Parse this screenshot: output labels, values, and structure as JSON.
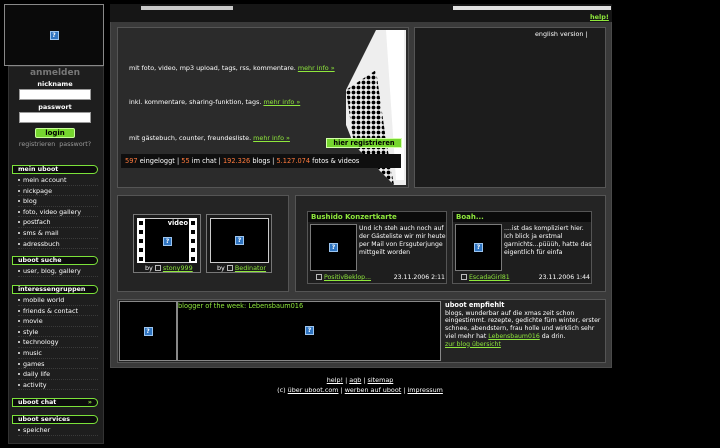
{
  "topbar": {
    "help": "help!"
  },
  "login": {
    "title": "anmelden",
    "nickname_label": "nickname",
    "password_label": "passwort",
    "login_button": "login",
    "register_link": "registrieren",
    "forgot_link": "passwort?"
  },
  "sidebar": {
    "sections": [
      {
        "title": "mein uboot",
        "items": [
          "mein account",
          "nickpage",
          "blog",
          "foto, video gallery",
          "postfach",
          "sms & mail",
          "adressbuch"
        ]
      },
      {
        "title": "uboot suche",
        "items": [
          "user, blog, gallery"
        ]
      },
      {
        "title": "interessengruppen",
        "items": [
          "mobile world",
          "friends & contact",
          "movie",
          "style",
          "technology",
          "music",
          "games",
          "daily life",
          "activity"
        ]
      },
      {
        "title": "uboot chat",
        "extra": "»",
        "items": []
      },
      {
        "title": "uboot services",
        "items": [
          "speicher"
        ]
      }
    ]
  },
  "promo": {
    "line1": "mit foto, video, mp3 upload, tags, rss, kommentare.",
    "line2": "inkl. kommentare, sharing-funktion, tags.",
    "line3": "mit gästebuch, counter, freundesliste.",
    "more_info": "mehr info »",
    "register_button": "hier registrieren",
    "stats": {
      "loggedin_count": "597",
      "loggedin_label": "eingeloggt",
      "chat_count": "55",
      "chat_label": "im chat",
      "blogs_count": "192.326",
      "blogs_label": "blogs",
      "media_count": "5.127.074",
      "media_label": "fotos & videos"
    }
  },
  "english": {
    "link": "english version",
    "sep": "|"
  },
  "gallery": {
    "items": [
      {
        "overlay": "video",
        "by": "by",
        "user": "stony999"
      },
      {
        "by": "by",
        "user": "Bedinator"
      }
    ]
  },
  "blogs": [
    {
      "title": "Bushido Konzertkarte",
      "text": "Und ich steh auch noch auf der Gästeliste wir mir heute per Mail von Ersguterjunge mittgeilt worden",
      "user": "PositivBeklop...",
      "date": "23.11.2006 2:11"
    },
    {
      "title": "Boah...",
      "text": "....ist das kompliziert hier. Ich blick ja erstmal garnichts...püüüh, hatte das eigentlich für einfa",
      "user": "EscadaGirl81",
      "date": "23.11.2006 1:44"
    }
  ],
  "blogger_week": {
    "label": "blogger of the week:",
    "name": "Lebensbaum016"
  },
  "recommend": {
    "title": "uboot empfiehlt",
    "text": "blogs, wunderbar auf die xmas zeit schon eingestimmt. rezepte, gedichte fürn winter, erster schnee, abendstern, frau holle und wirklich sehr viel mehr hat",
    "user": "Lebensbaum016",
    "tail": "da drin.",
    "link": "zur blog übersicht"
  },
  "footer": {
    "row1": [
      "help!",
      "agb",
      "sitemap"
    ],
    "copyright": "(c)",
    "row2": [
      "über uboot.com",
      "werben auf uboot",
      "impressum"
    ]
  },
  "colors": {
    "accent": "#8fe83c",
    "stat_number": "#ff7a3d",
    "panel": "#242424",
    "background": "#000000"
  }
}
